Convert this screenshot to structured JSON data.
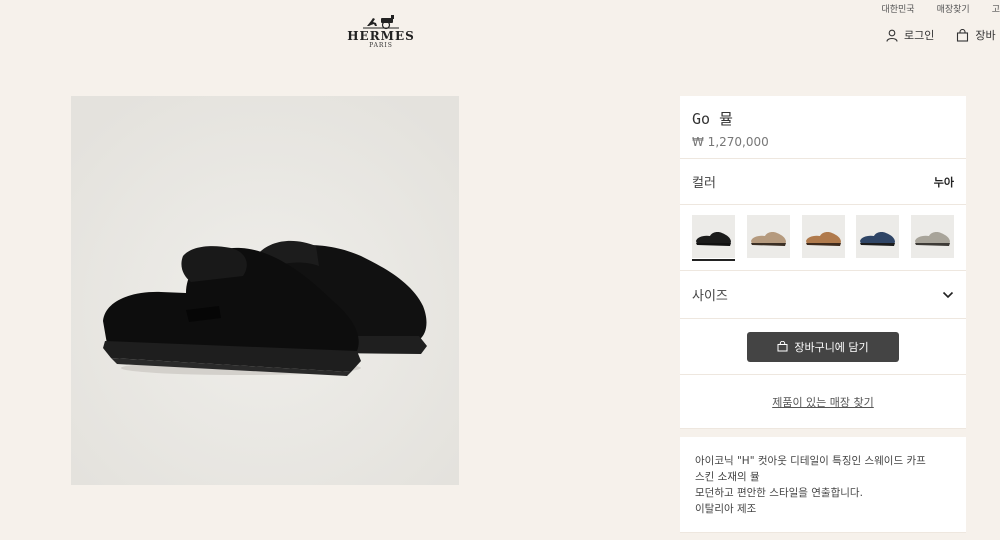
{
  "header": {
    "top_links": [
      "대한민국",
      "매장찾기",
      "고"
    ],
    "logo": {
      "brand": "HERMES",
      "city": "PARIS"
    },
    "login_label": "로그인",
    "cart_label": "장바"
  },
  "product": {
    "title": "Go 뮬",
    "price": "₩ 1,270,000",
    "color_label": "컬러",
    "color_value": "누아",
    "swatches": [
      {
        "name": "black",
        "color": "#1b1b1b",
        "sole": "#111111"
      },
      {
        "name": "beige",
        "color": "#b59a7e",
        "sole": "#3a2e24"
      },
      {
        "name": "tan",
        "color": "#b07a4c",
        "sole": "#3e2a1c"
      },
      {
        "name": "navy",
        "color": "#2f4566",
        "sole": "#1c1c1c"
      },
      {
        "name": "grey",
        "color": "#a8a49a",
        "sole": "#3d3a36"
      }
    ],
    "selected_swatch": 0,
    "size_label": "사이즈",
    "add_to_cart_label": "장바구니에 담기",
    "store_link_label": "제품이 있는 매장 찾기",
    "description": [
      "아이코닉 \"H\" 컷아웃 디테일이 특징인 스웨이드 카프",
      "스킨 소재의 뮬",
      "모던하고 편안한 스타일을 연출합니다.",
      "이탈리아 제조"
    ]
  },
  "colors": {
    "background": "#f6f1eb",
    "panel": "#ffffff",
    "button": "#444444",
    "image_bg": "#ebe9e4"
  }
}
